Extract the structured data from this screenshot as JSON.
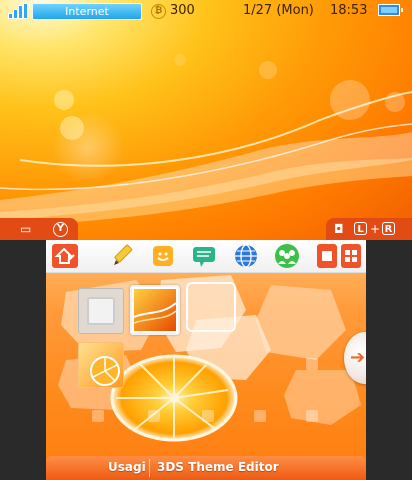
{
  "status_bar": {
    "network_label": "Internet",
    "coin_symbol": "₿",
    "coins": "300",
    "date": "1/27 (Mon)",
    "time": "18:53"
  },
  "top_tabs": {
    "left": {
      "camera_glyph": "▭",
      "y_button": "Y"
    },
    "right": {
      "camera_glyph": "◘",
      "l_button": "L",
      "plus": "+",
      "r_button": "R"
    }
  },
  "toolbar": {
    "icons": [
      "home-settings-icon",
      "pencil-icon",
      "smiley-icon",
      "chat-icon",
      "globe-icon",
      "friends-icon"
    ],
    "right_buttons": [
      "single-view-icon",
      "grid-view-icon"
    ]
  },
  "bottom_bar": {
    "name": "Usagi",
    "title": "3DS Theme Editor"
  },
  "colors": {
    "accent": "#e24b14",
    "bar_orange": "#ef5a14",
    "background": "#2a2a2a"
  }
}
